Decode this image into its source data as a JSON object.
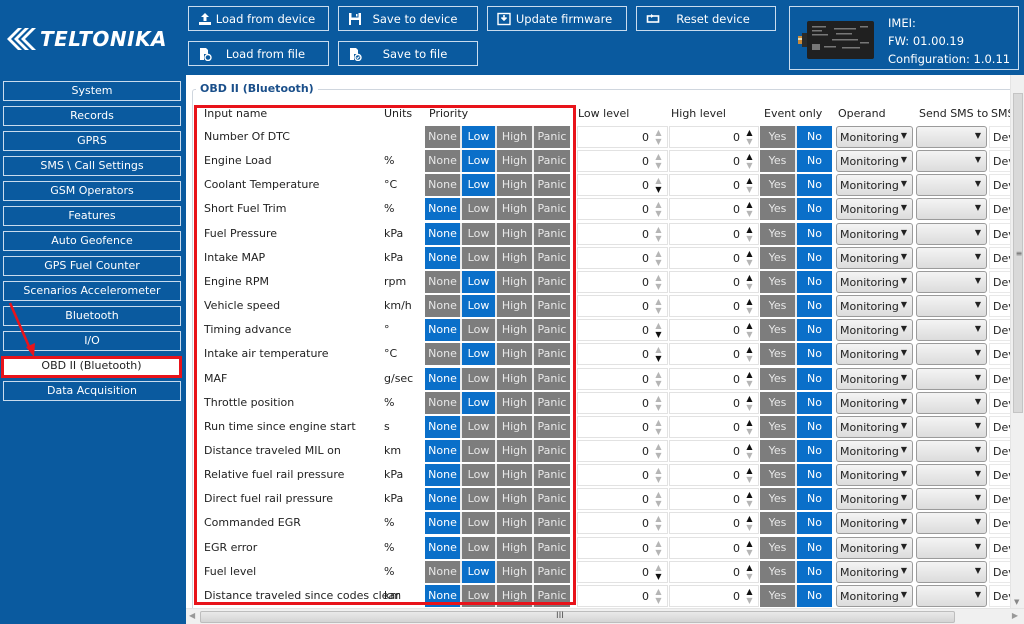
{
  "brand": {
    "logo_text": "TELTONIKA"
  },
  "toolbar": {
    "load_from_device": "Load from device",
    "save_to_device": "Save to device",
    "update_firmware": "Update firmware",
    "reset_device": "Reset device",
    "load_from_file": "Load from file",
    "save_to_file": "Save to file"
  },
  "device": {
    "imei": "IMEI:",
    "fw": "FW: 01.00.19",
    "configuration": "Configuration: 1.0.11"
  },
  "sidebar": {
    "active": "OBD II (Bluetooth)",
    "items": [
      {
        "label": "System"
      },
      {
        "label": "Records"
      },
      {
        "label": "GPRS"
      },
      {
        "label": "SMS \\ Call Settings"
      },
      {
        "label": "GSM Operators"
      },
      {
        "label": "Features"
      },
      {
        "label": "Auto Geofence"
      },
      {
        "label": "GPS Fuel Counter"
      },
      {
        "label": "Scenarios Accelerometer"
      },
      {
        "label": "Bluetooth"
      },
      {
        "label": "I/O"
      },
      {
        "label": "OBD II (Bluetooth)"
      },
      {
        "label": "Data Acquisition"
      }
    ]
  },
  "panel": {
    "title": "OBD II (Bluetooth)",
    "columns": {
      "input_name": "Input name",
      "units": "Units",
      "priority": "Priority",
      "low_level": "Low level",
      "high_level": "High level",
      "event_only": "Event only",
      "operand": "Operand",
      "send_sms_to": "Send SMS to",
      "sms_text": "SMS"
    },
    "priority_options": [
      "None",
      "Low",
      "High",
      "Panic"
    ],
    "event_options": [
      "Yes",
      "No"
    ],
    "rows": [
      {
        "name": "Number Of DTC",
        "unit": "",
        "priority": "Low",
        "low": "0",
        "high": "0",
        "event_only": "No",
        "operand": "Monitoring",
        "send_sms_to": "",
        "sms_text": "Dev"
      },
      {
        "name": "Engine Load",
        "unit": "%",
        "priority": "Low",
        "low": "0",
        "high": "0",
        "event_only": "No",
        "operand": "Monitoring",
        "send_sms_to": "",
        "sms_text": "Dev"
      },
      {
        "name": "Coolant Temperature",
        "unit": "°C",
        "priority": "Low",
        "low": "0",
        "high": "0",
        "event_only": "No",
        "operand": "Monitoring",
        "send_sms_to": "",
        "sms_text": "Dev"
      },
      {
        "name": "Short Fuel Trim",
        "unit": "%",
        "priority": "None",
        "low": "0",
        "high": "0",
        "event_only": "No",
        "operand": "Monitoring",
        "send_sms_to": "",
        "sms_text": "Dev"
      },
      {
        "name": "Fuel Pressure",
        "unit": "kPa",
        "priority": "None",
        "low": "0",
        "high": "0",
        "event_only": "No",
        "operand": "Monitoring",
        "send_sms_to": "",
        "sms_text": "Dev"
      },
      {
        "name": "Intake MAP",
        "unit": "kPa",
        "priority": "None",
        "low": "0",
        "high": "0",
        "event_only": "No",
        "operand": "Monitoring",
        "send_sms_to": "",
        "sms_text": "Dev"
      },
      {
        "name": "Engine RPM",
        "unit": "rpm",
        "priority": "Low",
        "low": "0",
        "high": "0",
        "event_only": "No",
        "operand": "Monitoring",
        "send_sms_to": "",
        "sms_text": "Dev"
      },
      {
        "name": "Vehicle speed",
        "unit": "km/h",
        "priority": "Low",
        "low": "0",
        "high": "0",
        "event_only": "No",
        "operand": "Monitoring",
        "send_sms_to": "",
        "sms_text": "Dev"
      },
      {
        "name": "Timing advance",
        "unit": "°",
        "priority": "None",
        "low": "0",
        "high": "0",
        "event_only": "No",
        "operand": "Monitoring",
        "send_sms_to": "",
        "sms_text": "Dev"
      },
      {
        "name": "Intake air temperature",
        "unit": "°C",
        "priority": "Low",
        "low": "0",
        "high": "0",
        "event_only": "No",
        "operand": "Monitoring",
        "send_sms_to": "",
        "sms_text": "Dev"
      },
      {
        "name": "MAF",
        "unit": "g/sec",
        "priority": "None",
        "low": "0",
        "high": "0",
        "event_only": "No",
        "operand": "Monitoring",
        "send_sms_to": "",
        "sms_text": "Dev"
      },
      {
        "name": "Throttle position",
        "unit": "%",
        "priority": "Low",
        "low": "0",
        "high": "0",
        "event_only": "No",
        "operand": "Monitoring",
        "send_sms_to": "",
        "sms_text": "Dev"
      },
      {
        "name": "Run time since engine start",
        "unit": "s",
        "priority": "None",
        "low": "0",
        "high": "0",
        "event_only": "No",
        "operand": "Monitoring",
        "send_sms_to": "",
        "sms_text": "Dev"
      },
      {
        "name": "Distance traveled MIL on",
        "unit": "km",
        "priority": "None",
        "low": "0",
        "high": "0",
        "event_only": "No",
        "operand": "Monitoring",
        "send_sms_to": "",
        "sms_text": "Dev"
      },
      {
        "name": "Relative fuel rail pressure",
        "unit": "kPa",
        "priority": "None",
        "low": "0",
        "high": "0",
        "event_only": "No",
        "operand": "Monitoring",
        "send_sms_to": "",
        "sms_text": "Dev"
      },
      {
        "name": "Direct fuel rail pressure",
        "unit": "kPa",
        "priority": "None",
        "low": "0",
        "high": "0",
        "event_only": "No",
        "operand": "Monitoring",
        "send_sms_to": "",
        "sms_text": "Dev"
      },
      {
        "name": "Commanded EGR",
        "unit": "%",
        "priority": "None",
        "low": "0",
        "high": "0",
        "event_only": "No",
        "operand": "Monitoring",
        "send_sms_to": "",
        "sms_text": "Dev"
      },
      {
        "name": "EGR error",
        "unit": "%",
        "priority": "None",
        "low": "0",
        "high": "0",
        "event_only": "No",
        "operand": "Monitoring",
        "send_sms_to": "",
        "sms_text": "Dev"
      },
      {
        "name": "Fuel level",
        "unit": "%",
        "priority": "Low",
        "low": "0",
        "high": "0",
        "event_only": "No",
        "operand": "Monitoring",
        "send_sms_to": "",
        "sms_text": "Dev"
      },
      {
        "name": "Distance traveled since codes clear",
        "unit": "km",
        "priority": "None",
        "low": "0",
        "high": "0",
        "event_only": "No",
        "operand": "Monitoring",
        "send_sms_to": "",
        "sms_text": "Dev"
      }
    ]
  },
  "scrollbars": {
    "h_grip": "III",
    "v_grip": "≡"
  },
  "colors": {
    "brand_blue": "#0a5a9f",
    "selected_blue": "#0a6fc9",
    "unselected_gray": "#7d7d7d",
    "highlight_red": "#e8131a"
  }
}
